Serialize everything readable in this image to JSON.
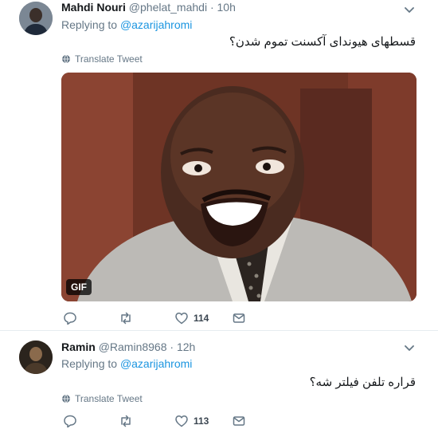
{
  "tweets": [
    {
      "name": "Mahdi Nouri",
      "handle": "@phelat_mahdi",
      "separator": "·",
      "time": "10h",
      "replying_to_label": "Replying to",
      "replying_to_handle": "@azarijahromi",
      "text": "قسطهای هیوندای آکسنت تموم شدن؟",
      "translate_label": "Translate Tweet",
      "media_badge": "GIF",
      "likes": "114"
    },
    {
      "name": "Ramin",
      "handle": "@Ramin8968",
      "separator": "·",
      "time": "12h",
      "replying_to_label": "Replying to",
      "replying_to_handle": "@azarijahromi",
      "text": "قراره تلفن فیلتر شه؟",
      "translate_label": "Translate Tweet",
      "likes": "113"
    }
  ],
  "icons": [
    "chevron-down-icon",
    "globe-icon",
    "reply-icon",
    "retweet-icon",
    "like-icon",
    "message-icon"
  ],
  "colors": {
    "link": "#1b95e0",
    "secondary_text": "#657786",
    "primary_text": "#14171a",
    "divider": "#e6ecf0"
  }
}
